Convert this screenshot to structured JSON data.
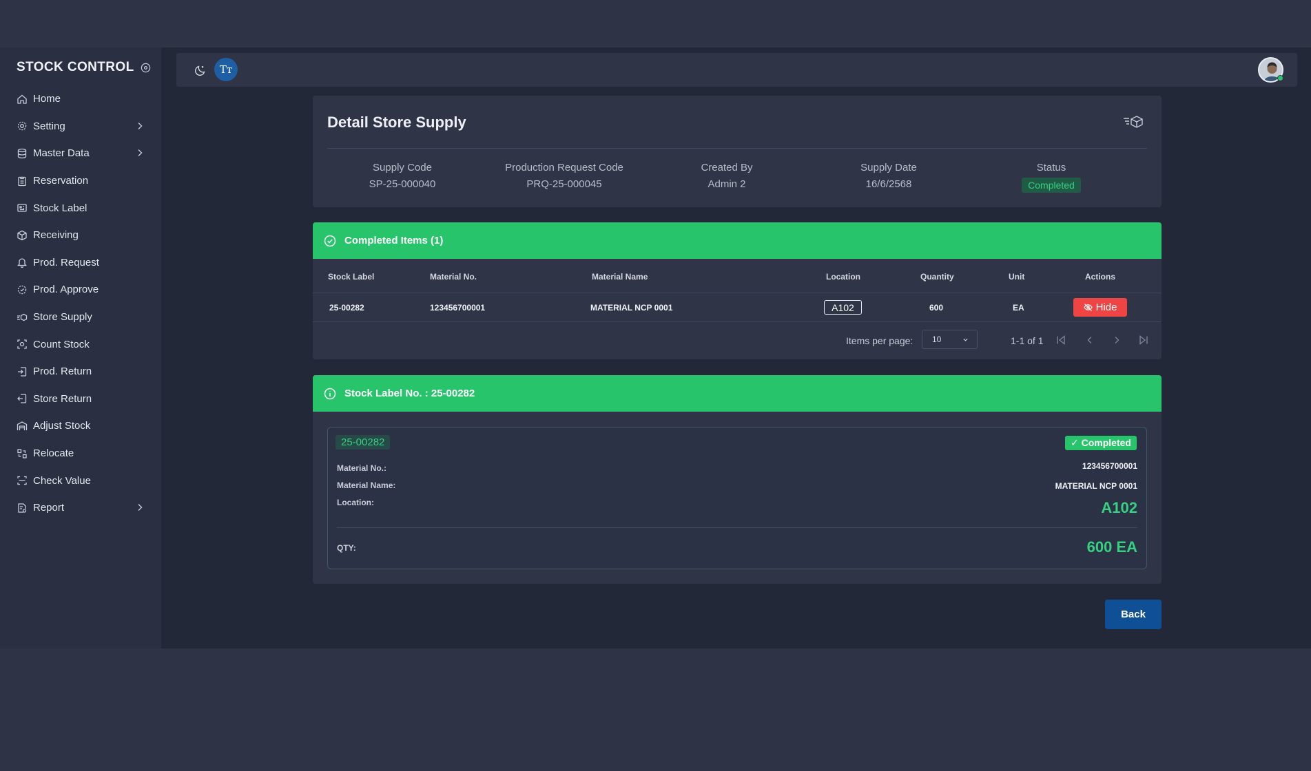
{
  "sidebar": {
    "brand": "STOCK CONTROL",
    "items": [
      {
        "label": "Home",
        "icon": "home-icon"
      },
      {
        "label": "Setting",
        "icon": "gear-icon",
        "has_submenu": true
      },
      {
        "label": "Master Data",
        "icon": "database-icon",
        "has_submenu": true
      },
      {
        "label": "Reservation",
        "icon": "clipboard-icon"
      },
      {
        "label": "Stock Label",
        "icon": "label-icon"
      },
      {
        "label": "Receiving",
        "icon": "package-icon"
      },
      {
        "label": "Prod. Request",
        "icon": "bell-icon"
      },
      {
        "label": "Prod. Approve",
        "icon": "gear-check-icon"
      },
      {
        "label": "Store Supply",
        "icon": "supply-icon"
      },
      {
        "label": "Count Stock",
        "icon": "scan-icon"
      },
      {
        "label": "Prod. Return",
        "icon": "return-in-icon"
      },
      {
        "label": "Store Return",
        "icon": "return-out-icon"
      },
      {
        "label": "Adjust Stock",
        "icon": "warehouse-icon"
      },
      {
        "label": "Relocate",
        "icon": "relocate-icon"
      },
      {
        "label": "Check Value",
        "icon": "check-value-icon"
      },
      {
        "label": "Report",
        "icon": "report-icon",
        "has_submenu": true
      }
    ]
  },
  "topbar": {
    "font_button_label": "Tт"
  },
  "detail": {
    "title": "Detail Store Supply",
    "fields": [
      {
        "label": "Supply Code",
        "value": "SP-25-000040"
      },
      {
        "label": "Production Request Code",
        "value": "PRQ-25-000045"
      },
      {
        "label": "Created By",
        "value": "Admin 2"
      },
      {
        "label": "Supply Date",
        "value": "16/6/2568"
      }
    ],
    "status_label": "Status",
    "status_value": "Completed"
  },
  "completed": {
    "header": "Completed Items (1)",
    "columns": [
      "Stock Label",
      "Material No.",
      "Material Name",
      "Location",
      "Quantity",
      "Unit",
      "Actions"
    ],
    "rows": [
      {
        "stock_label": "25-00282",
        "material_no": "123456700001",
        "material_name": "MATERIAL NCP 0001",
        "location": "A102",
        "quantity": "600",
        "unit": "EA",
        "action": "Hide"
      }
    ],
    "pager": {
      "items_per_page_label": "Items per page:",
      "items_per_page": "10",
      "range": "1-1 of 1"
    }
  },
  "stock_label": {
    "header": "Stock Label No. : 25-00282",
    "tag": "25-00282",
    "status": "✓ Completed",
    "material_no_label": "Material No.:",
    "material_no": "123456700001",
    "material_name_label": "Material Name:",
    "material_name": "MATERIAL NCP 0001",
    "location_label": "Location:",
    "location": "A102",
    "qty_label": "QTY:",
    "qty": "600 EA"
  },
  "back_label": "Back",
  "colors": {
    "page_bg": "#2e3346",
    "panel_bg": "#2f3447",
    "accent_green": "#28c46b",
    "danger_red": "#ef4444",
    "primary_blue": "#0e4f95"
  }
}
